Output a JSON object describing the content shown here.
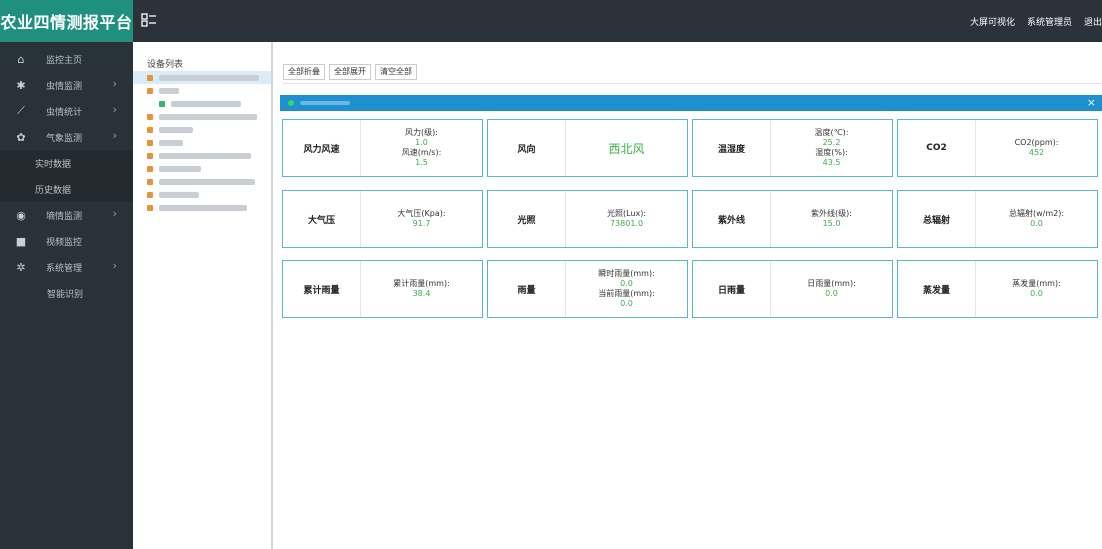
{
  "brand": "农业四情测报平台",
  "top_links": [
    "大屏可视化",
    "系统管理员",
    "退出"
  ],
  "menu": [
    {
      "icon": "home-icon",
      "glyph": "⌂",
      "label": "监控主页",
      "arrow": false
    },
    {
      "icon": "insect-icon",
      "glyph": "✱",
      "label": "虫情监测",
      "arrow": true
    },
    {
      "icon": "chart-icon",
      "glyph": "⟋",
      "label": "虫情统计",
      "arrow": true
    },
    {
      "icon": "weather-icon",
      "glyph": "✿",
      "label": "气象监测",
      "arrow": true
    }
  ],
  "weather_sub": [
    "实时数据",
    "历史数据"
  ],
  "menu2": [
    {
      "icon": "soil-icon",
      "glyph": "◉",
      "label": "墒情监测",
      "arrow": true
    },
    {
      "icon": "video-icon",
      "glyph": "■",
      "label": "视频监控",
      "arrow": false
    },
    {
      "icon": "gear-icon",
      "glyph": "✲",
      "label": "系统管理",
      "arrow": true
    }
  ],
  "system_sub": [
    "智能识别"
  ],
  "tree_title": "设备列表",
  "toolbar": {
    "collapse_all": "全部折叠",
    "expand_all": "全部展开",
    "clear_all": "清空全部"
  },
  "panel": {
    "close": "×"
  },
  "cards": [
    {
      "key": "wind-speed",
      "label": "风力风速",
      "lines": [
        [
          "风力(级):",
          "1.0"
        ],
        [
          "风速(m/s):",
          "1.5"
        ]
      ]
    },
    {
      "key": "wind-direction",
      "label": "风向",
      "big": "西北风"
    },
    {
      "key": "temp-humidity",
      "label": "温湿度",
      "lines": [
        [
          "温度(℃):",
          "25.2"
        ],
        [
          "湿度(%):",
          "43.5"
        ]
      ]
    },
    {
      "key": "co2",
      "label": "CO2",
      "lines": [
        [
          "CO2(ppm):",
          "452"
        ]
      ]
    },
    {
      "key": "pressure",
      "label": "大气压",
      "lines": [
        [
          "大气压(Kpa):",
          "91.7"
        ]
      ]
    },
    {
      "key": "light",
      "label": "光照",
      "lines": [
        [
          "光照(Lux):",
          "73801.0"
        ]
      ]
    },
    {
      "key": "uv",
      "label": "紫外线",
      "lines": [
        [
          "紫外线(级):",
          "15.0"
        ]
      ]
    },
    {
      "key": "radiation",
      "label": "总辐射",
      "lines": [
        [
          "总辐射(w/m2):",
          "0.0"
        ]
      ]
    },
    {
      "key": "accum-rain",
      "label": "累计雨量",
      "lines": [
        [
          "累计雨量(mm):",
          "38.4"
        ]
      ]
    },
    {
      "key": "rainfall",
      "label": "雨量",
      "lines": [
        [
          "瞬时雨量(mm):",
          "0.0"
        ],
        [
          "当前雨量(mm):",
          "0.0"
        ]
      ]
    },
    {
      "key": "daily-rain",
      "label": "日雨量",
      "lines": [
        [
          "日雨量(mm):",
          "0.0"
        ]
      ]
    },
    {
      "key": "evaporation",
      "label": "蒸发量",
      "lines": [
        [
          "蒸发量(mm):",
          "0.0"
        ]
      ]
    }
  ],
  "colors": {
    "brand": "#1f8f7e",
    "sidebar": "#2a3239",
    "panel_header": "#1e90d0",
    "card_border": "#5bb8c2",
    "value_green": "#3cae4a"
  }
}
